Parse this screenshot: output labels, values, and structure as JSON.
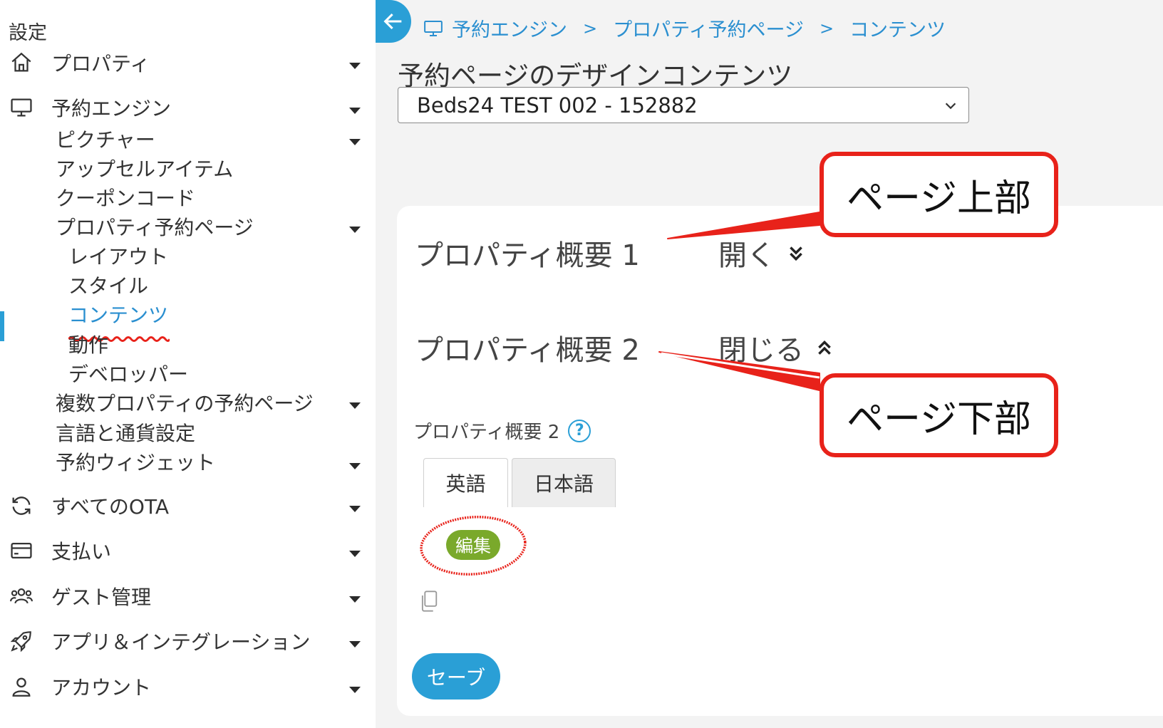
{
  "sidebar": {
    "title": "設定",
    "items": [
      {
        "label": "プロパティ",
        "icon": "home-icon"
      },
      {
        "label": "予約エンジン",
        "icon": "monitor-icon"
      },
      {
        "label": "すべてのOTA",
        "icon": "sync-icon"
      },
      {
        "label": "支払い",
        "icon": "credit-card-icon"
      },
      {
        "label": "ゲスト管理",
        "icon": "users-icon"
      },
      {
        "label": "アプリ＆インテグレーション",
        "icon": "rocket-icon"
      },
      {
        "label": "アカウント",
        "icon": "user-icon"
      }
    ],
    "booking_engine_sub": [
      {
        "label": "ピクチャー"
      },
      {
        "label": "アップセルアイテム"
      },
      {
        "label": "クーポンコード"
      },
      {
        "label": "プロパティ予約ページ"
      },
      {
        "label": "複数プロパティの予約ページ"
      },
      {
        "label": "言語と通貨設定"
      },
      {
        "label": "予約ウィジェット"
      }
    ],
    "booking_page_sub": [
      {
        "label": "レイアウト"
      },
      {
        "label": "スタイル"
      },
      {
        "label": "コンテンツ",
        "active": true
      },
      {
        "label": "動作"
      },
      {
        "label": "デベロッパー"
      }
    ]
  },
  "breadcrumb": [
    "予約エンジン",
    "プロパティ予約ページ",
    "コンテンツ"
  ],
  "breadcrumb_separator": ">",
  "page_title": "予約ページのデザインコンテンツ",
  "property_select": {
    "value": "Beds24 TEST 002 - 152882"
  },
  "sections": [
    {
      "title": "プロパティ概要 1",
      "toggle": "開く"
    },
    {
      "title": "プロパティ概要 2",
      "toggle": "閉じる"
    }
  ],
  "field": {
    "label": "プロパティ概要 2",
    "help": "?"
  },
  "tabs": [
    "英語",
    "日本語"
  ],
  "edit_label": "編集",
  "save_label": "セーブ",
  "annotations": {
    "top": "ページ上部",
    "bottom": "ページ下部"
  },
  "colors": {
    "accent": "#2a9fd6",
    "edit_green": "#7aa92b",
    "annotation_red": "#e8221a"
  }
}
